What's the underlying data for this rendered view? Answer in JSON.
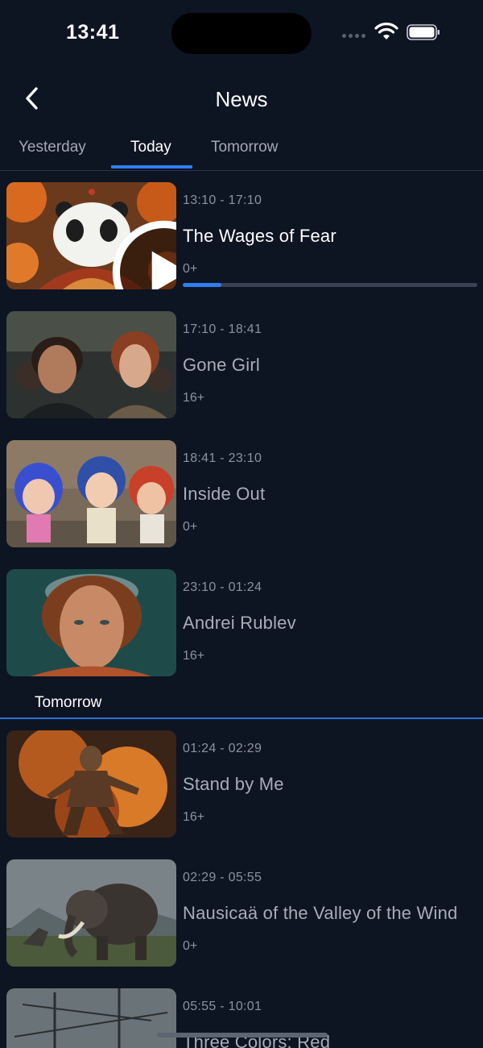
{
  "status_bar": {
    "time": "13:41"
  },
  "nav": {
    "title": "News"
  },
  "tabs": [
    {
      "label": "Yesterday",
      "active": false
    },
    {
      "label": "Today",
      "active": true
    },
    {
      "label": "Tomorrow",
      "active": false
    }
  ],
  "programs": [
    {
      "time": "13:10 - 17:10",
      "title": "The Wages of Fear",
      "rating": "0+",
      "progress": 0.13,
      "playing": true
    },
    {
      "time": "17:10 - 18:41",
      "title": "Gone Girl",
      "rating": "16+"
    },
    {
      "time": "18:41 - 23:10",
      "title": "Inside Out",
      "rating": "0+"
    },
    {
      "time": "23:10 - 01:24",
      "title": "Andrei Rublev",
      "rating": "16+"
    }
  ],
  "section": {
    "label": "Tomorrow"
  },
  "tomorrow_programs": [
    {
      "time": "01:24 - 02:29",
      "title": "Stand by Me",
      "rating": "16+"
    },
    {
      "time": "02:29 - 05:55",
      "title": "Nausicaä of the Valley of the Wind",
      "rating": "0+"
    },
    {
      "time": "05:55 - 10:01",
      "title": "Three Colors: Red",
      "rating": ""
    }
  ],
  "colors": {
    "background": "#0d1422",
    "accent": "#2f7ef3",
    "text_muted": "#8c93a0"
  }
}
